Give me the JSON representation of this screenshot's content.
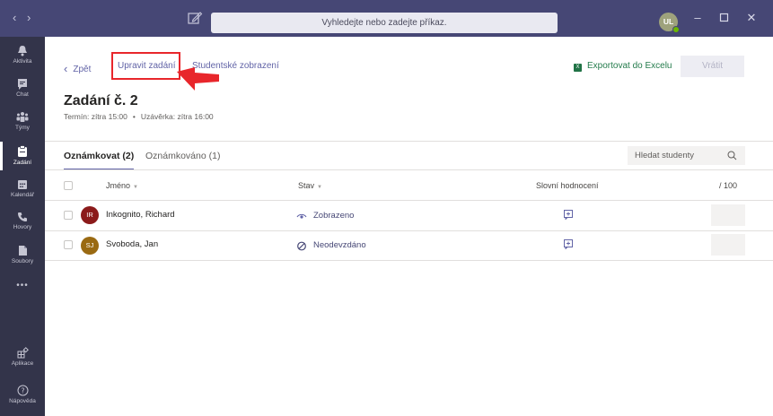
{
  "titlebar": {
    "search_placeholder": "Vyhledejte nebo zadejte příkaz.",
    "user_initials": "UL",
    "accent_color": "#464775"
  },
  "rail": {
    "items": [
      {
        "label": "Aktivita",
        "icon": "bell-icon"
      },
      {
        "label": "Chat",
        "icon": "chat-icon"
      },
      {
        "label": "Týmy",
        "icon": "teams-icon"
      },
      {
        "label": "Zadání",
        "icon": "assignments-icon",
        "active": true
      },
      {
        "label": "Kalendář",
        "icon": "calendar-icon"
      },
      {
        "label": "Hovory",
        "icon": "phone-icon"
      },
      {
        "label": "Soubory",
        "icon": "files-icon"
      }
    ],
    "more": "•••",
    "apps_label": "Aplikace",
    "help_label": "Nápověda"
  },
  "toolbar": {
    "back_label": "Zpět",
    "edit_label": "Upravit zadání",
    "student_view_label": "Studentské zobrazení",
    "export_label": "Exportovat do Excelu",
    "return_label": "Vrátit"
  },
  "assignment": {
    "title": "Zadání č. 2",
    "due": "Termín: zítra 15:00",
    "close": "Uzávěrka: zítra 16:00"
  },
  "tabs": {
    "to_grade": "Oznámkovat (2)",
    "graded": "Oznámkováno (1)",
    "search_placeholder": "Hledat studenty"
  },
  "table": {
    "columns": {
      "name": "Jméno",
      "status": "Stav",
      "feedback": "Slovní hodnocení",
      "points": "/ 100"
    },
    "rows": [
      {
        "initials": "IR",
        "name": "Inkognito, Richard",
        "status": "Zobrazeno",
        "status_icon": "eye-icon",
        "avatar_color": "#8b1a1a"
      },
      {
        "initials": "SJ",
        "name": "Svoboda, Jan",
        "status": "Neodevzdáno",
        "status_icon": "not-submitted-icon",
        "avatar_color": "#9a6a12"
      }
    ]
  },
  "colors": {
    "brand": "#6264a7",
    "highlight": "#e8262b",
    "excel": "#217346"
  }
}
